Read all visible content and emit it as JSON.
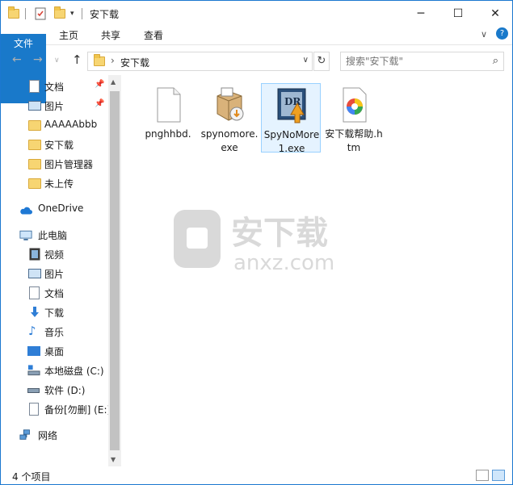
{
  "window": {
    "title": "安下载",
    "controls": {
      "minimize": "─",
      "maximize": "☐",
      "close": "✕"
    }
  },
  "ribbon": {
    "tabs": [
      {
        "label": "文件",
        "active": true
      },
      {
        "label": "主页"
      },
      {
        "label": "共享"
      },
      {
        "label": "查看"
      }
    ],
    "expand_glyph": "∨",
    "help_glyph": "?"
  },
  "address": {
    "path": "安下载",
    "search_placeholder": "搜索\"安下载\""
  },
  "nav": {
    "quick_access": [
      {
        "label": "文档",
        "icon": "document-icon",
        "pinned": true
      },
      {
        "label": "图片",
        "icon": "picture-icon",
        "pinned": true
      },
      {
        "label": "AAAAAbbb",
        "icon": "folder-icon"
      },
      {
        "label": "安下载",
        "icon": "folder-icon"
      },
      {
        "label": "图片管理器",
        "icon": "folder-icon"
      },
      {
        "label": "未上传",
        "icon": "folder-icon"
      }
    ],
    "onedrive": "OneDrive",
    "this_pc": "此电脑",
    "pc_items": [
      {
        "label": "视频",
        "icon": "video-icon"
      },
      {
        "label": "图片",
        "icon": "picture-icon"
      },
      {
        "label": "文档",
        "icon": "document-icon"
      },
      {
        "label": "下载",
        "icon": "download-icon"
      },
      {
        "label": "音乐",
        "icon": "music-icon"
      },
      {
        "label": "桌面",
        "icon": "desktop-icon"
      },
      {
        "label": "本地磁盘 (C:)",
        "icon": "local-disk-icon"
      },
      {
        "label": "软件 (D:)",
        "icon": "drive-icon"
      },
      {
        "label": "备份[勿删] (E:)",
        "icon": "drive-icon"
      }
    ],
    "network": "网络"
  },
  "files": [
    {
      "name": "pnghhbd.",
      "icon": "blank-file-icon",
      "selected": false
    },
    {
      "name": "spynomore.exe",
      "icon": "installer-icon",
      "selected": false
    },
    {
      "name": "SpyNoMore1.exe",
      "icon": "spynomore-app-icon",
      "selected": true
    },
    {
      "name": "安下载帮助.htm",
      "icon": "html-file-icon",
      "selected": false
    }
  ],
  "watermark": {
    "cn": "安下载",
    "en": "anxz.com"
  },
  "status": {
    "item_count": "4 个项目"
  }
}
